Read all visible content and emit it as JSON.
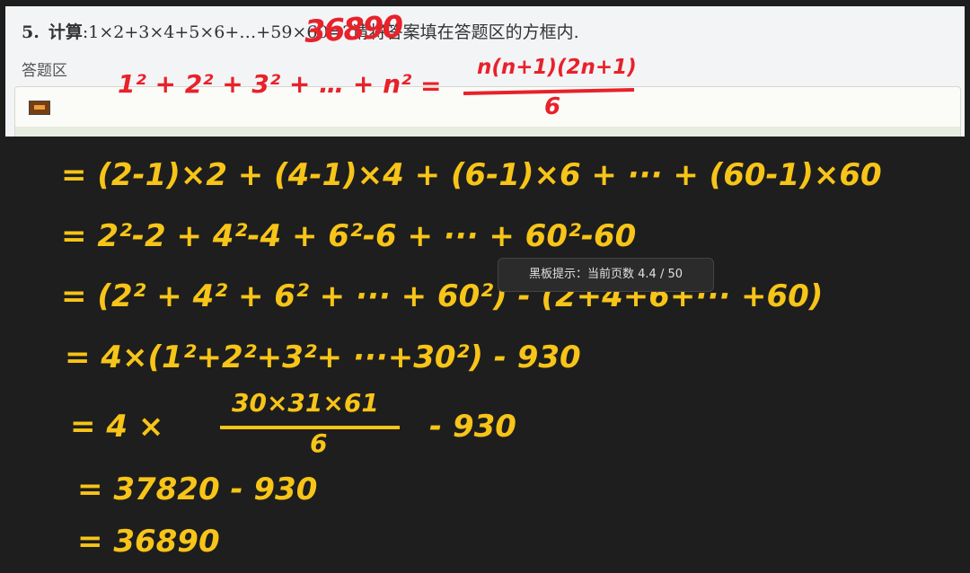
{
  "question": {
    "number": "5.",
    "label": "计算",
    "text": ":1×2+3×4+5×6+…+59×60=?请将答案填在答题区的方框内."
  },
  "answer_area": {
    "label": "答题区",
    "icon": "image-icon"
  },
  "red_handwriting": {
    "answer": "36890",
    "formula_lhs": "1² + 2² + 3² + … + n²",
    "formula_eq": "=",
    "formula_numerator": "n(n+1)(2n+1)",
    "formula_denominator": "6"
  },
  "blackboard": {
    "lines": [
      "= (2-1)×2 + (4-1)×4 + (6-1)×6 + ··· + (60-1)×60",
      "= 2²-2 + 4²-4 + 6²-6 + ··· + 60²-60",
      "= (2² + 4² + 6² + ··· + 60²) - (2+4+6+··· +60)",
      "= 4×(1²+2²+3²+ ···+30²) - 930"
    ],
    "fraction_line_prefix": "= 4 ×",
    "fraction_numerator": "30×31×61",
    "fraction_denominator": "6",
    "fraction_line_suffix": "- 930",
    "line6": "= 37820 - 930",
    "line7": "= 36890"
  },
  "tooltip": "黑板提示：当前页数 4.4 / 50",
  "colors": {
    "blackboard": "#1e1e1e",
    "chalk_yellow": "#f7c418",
    "ink_red": "#e8212a",
    "panel": "#f3f4f6"
  }
}
